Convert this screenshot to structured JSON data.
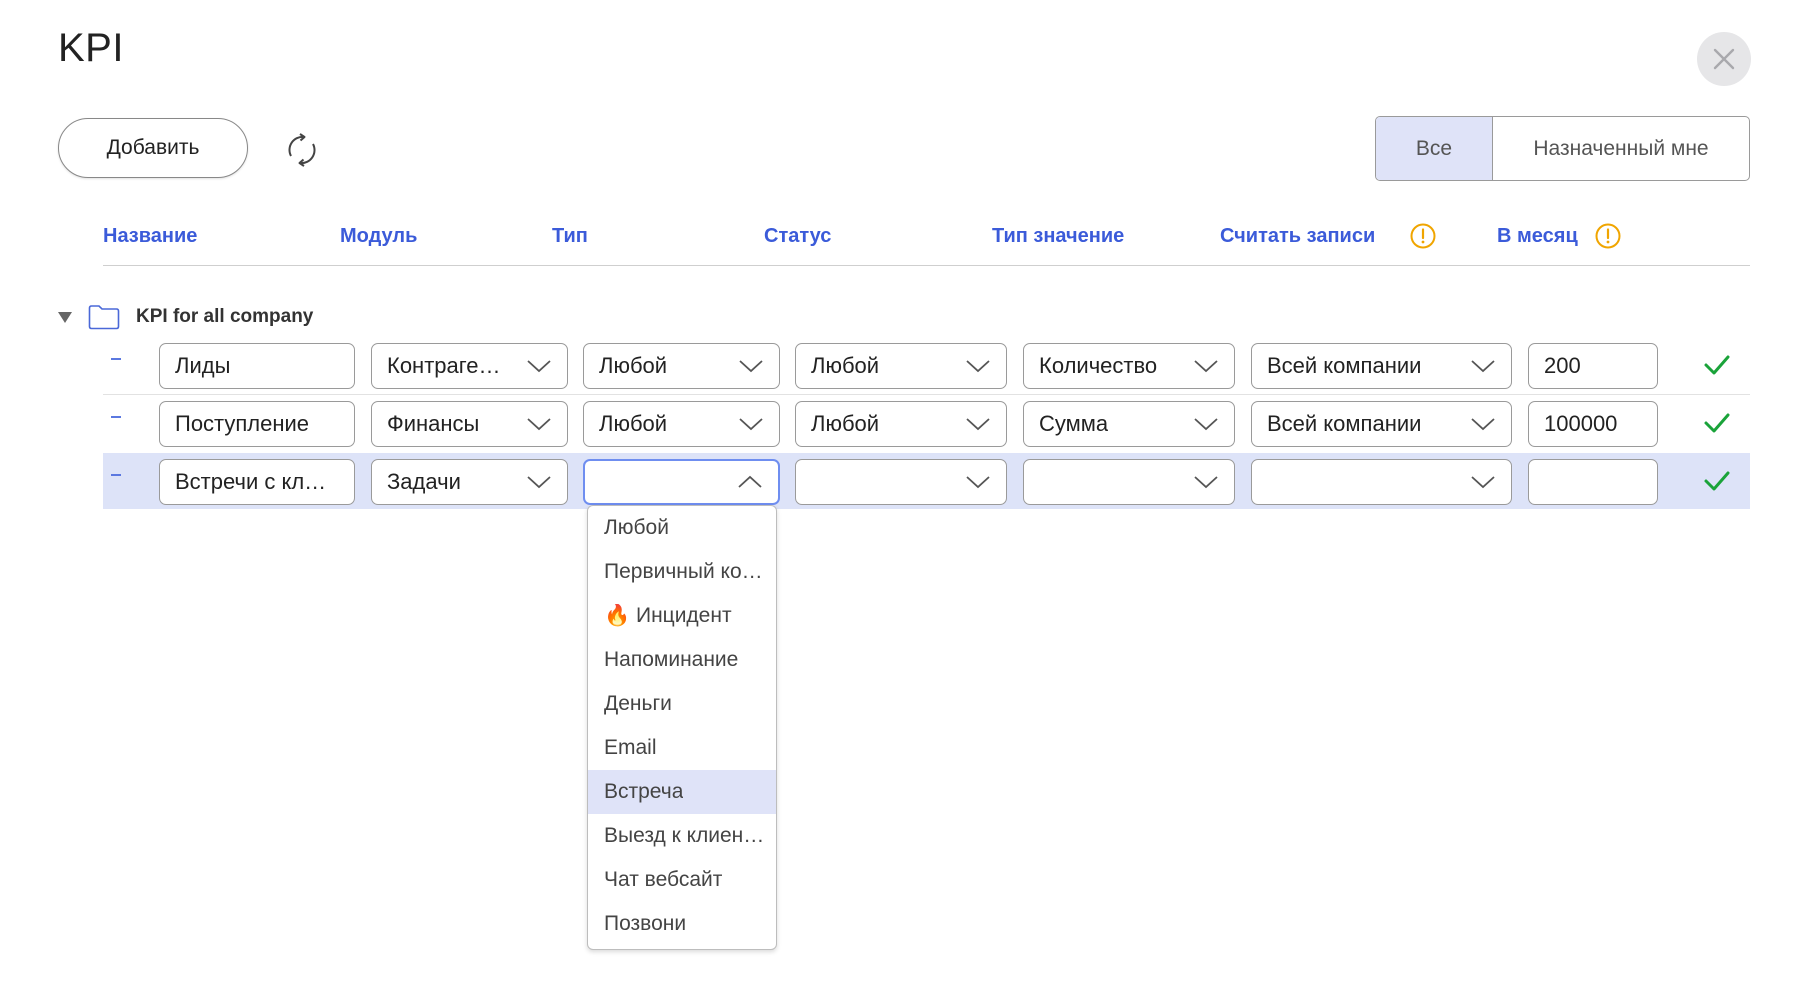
{
  "page": {
    "title": "KPI"
  },
  "toolbar": {
    "add_label": "Добавить"
  },
  "filter": {
    "all_label": "Все",
    "mine_label": "Назначенный мне",
    "active": "all"
  },
  "columns": {
    "name": "Название",
    "module": "Модуль",
    "type": "Тип",
    "status": "Статус",
    "value_type": "Тип значение",
    "count_records": "Считать записи",
    "per_month": "В месяц"
  },
  "group": {
    "label": "KPI for all company"
  },
  "rows": [
    {
      "name": "Лиды",
      "module": "Контраге…",
      "type": "Любой",
      "status": "Любой",
      "value_type": "Количество",
      "count_records": "Всей компании",
      "per_month": "200"
    },
    {
      "name": "Поступление",
      "module": "Финансы",
      "type": "Любой",
      "status": "Любой",
      "value_type": "Сумма",
      "count_records": "Всей компании",
      "per_month": "100000"
    },
    {
      "name": "Встречи с кл…",
      "module": "Задачи",
      "type": "",
      "status": "",
      "value_type": "",
      "count_records": "",
      "per_month": ""
    }
  ],
  "dropdown": {
    "items": [
      "Любой",
      "Первичный ко…",
      "🔥 Инцидент",
      "Напоминание",
      "Деньги",
      "Email",
      "Встреча",
      "Выезд к клиен…",
      "Чат вебсайт",
      "Позвони"
    ],
    "highlighted": "Встреча"
  },
  "colors": {
    "accent": "#3b5bd9",
    "highlight": "#dde3f8",
    "check": "#1aa33a",
    "warning": "#f0a500"
  },
  "icons": {
    "refresh": "refresh-icon",
    "close": "close-icon",
    "folder": "folder-icon",
    "warning": "warning-icon",
    "chevron": "chevron-down-icon",
    "check": "check-icon"
  }
}
